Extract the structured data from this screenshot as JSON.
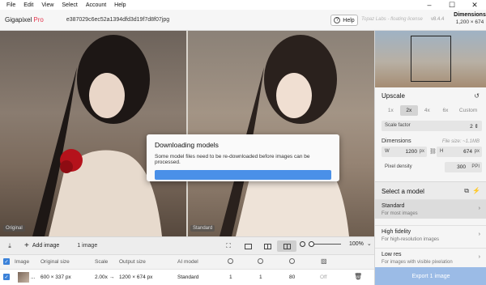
{
  "menu": [
    "File",
    "Edit",
    "View",
    "Select",
    "Account",
    "Help"
  ],
  "window_controls": [
    "–",
    "☐",
    "✕"
  ],
  "app": {
    "name": "Gigapixel",
    "edition": "Pro",
    "filename": "e387029c6ec52a1394dfd3d19f7d8f07jpg"
  },
  "header": {
    "help": "Help",
    "license": "Topaz Labs - floating license",
    "version": "v8.4.4",
    "dims_title": "Dimensions",
    "dims_value": "1,200 × 674"
  },
  "preview": {
    "left_label": "Original",
    "right_label": "Standard"
  },
  "modal": {
    "title": "Downloading models",
    "message": "Some model files need to be re-downloaded before images can be processed.",
    "progress": 1.0
  },
  "toolbar": {
    "add_image": "Add image",
    "image_count": "1 image",
    "zoom": "100%"
  },
  "table": {
    "headers": {
      "image": "Image",
      "original": "Original size",
      "scale": "Scale",
      "output": "Output size",
      "model": "AI model"
    },
    "row": {
      "name": "...",
      "original": "600 × 337 px",
      "scale": "2.00x →",
      "output": "1200 × 674 px",
      "model": "Standard",
      "c1": "1",
      "c2": "1",
      "c3": "80",
      "c4": "Off"
    }
  },
  "upscale": {
    "title": "Upscale",
    "tabs": [
      "1x",
      "2x",
      "4x",
      "6x",
      "Custom"
    ],
    "active_tab": "2x",
    "scale_factor_label": "Scale factor",
    "scale_factor": "2",
    "dimensions_label": "Dimensions",
    "file_size": "File size: ~1.1MB",
    "w_label": "W",
    "w_value": "1200",
    "h_label": "H",
    "h_value": "674",
    "unit": "px",
    "density_label": "Pixel density",
    "density_value": "300",
    "density_unit": "PPI"
  },
  "models": {
    "title": "Select a model",
    "items": [
      {
        "name": "Standard",
        "sub": "For most images",
        "selected": true
      },
      {
        "name": "High fidelity",
        "sub": "For high-resolution images",
        "selected": false
      },
      {
        "name": "Low res",
        "sub": "For images with visible pixelation",
        "selected": false
      }
    ]
  },
  "export": "Export 1 image",
  "colors": {
    "accent": "#3b82d9",
    "brand": "#e3364e",
    "progress": "#4a90e8",
    "export_bg": "#9bbbe6"
  }
}
